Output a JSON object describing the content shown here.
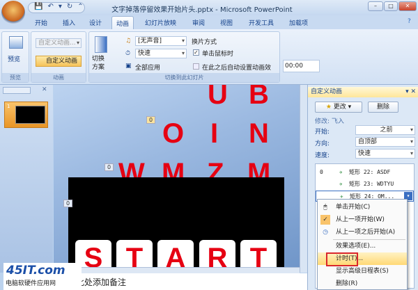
{
  "window": {
    "title": "文字掉落停留效果开始片头.pptx - Microsoft PowerPoint",
    "controls": [
      "–",
      "□",
      "✕"
    ]
  },
  "qat": {
    "items": [
      "💾",
      "↶",
      "▾",
      "↻",
      "⌃"
    ]
  },
  "tabs": [
    "开始",
    "插入",
    "设计",
    "动画",
    "幻灯片放映",
    "审阅",
    "视图",
    "开发工具",
    "加载项"
  ],
  "active_tab": "动画",
  "ribbon": {
    "preview": {
      "button": "预览",
      "group": "预览"
    },
    "animation": {
      "dropdown": "自定义动画...",
      "custom_button": "自定义动画",
      "group": "动画"
    },
    "transition": {
      "scheme_button": "切换方案",
      "sound": "[无声音]",
      "speed": "快速",
      "apply_all": "全部应用",
      "advance_title": "换片方式",
      "on_click": "单击鼠标时",
      "on_click_checked": true,
      "auto_after": "在此之后自动设置动画效果:",
      "auto_after_checked": false,
      "time": "00:00",
      "group": "切换到此幻灯片"
    }
  },
  "thumbnail": {
    "number": "1"
  },
  "slide": {
    "letters_row1": [
      "U",
      "B"
    ],
    "letters_row2": [
      "O",
      "I",
      "N"
    ],
    "letters_row3": [
      "W",
      "M",
      "Z",
      "M"
    ],
    "tiles": [
      "S",
      "T",
      "A",
      "R",
      "T"
    ],
    "tags": [
      "0",
      "0",
      "0"
    ]
  },
  "notes": {
    "placeholder": "单击此处添加备注"
  },
  "watermark": {
    "logo": "45IT.com",
    "tagline": "电脑软硬件应用网"
  },
  "task_pane": {
    "title": "自定义动画",
    "change_button": "更改",
    "remove_button": "删除",
    "modify": "修改: 飞入",
    "start_label": "开始:",
    "start_value": "之前",
    "direction_label": "方向:",
    "direction_value": "自顶部",
    "speed_label": "速度:",
    "speed_value": "快速",
    "list": [
      {
        "index": "0",
        "label": "矩形 22: ASDF"
      },
      {
        "index": "",
        "label": "矩形 23: WDTYU"
      },
      {
        "index": "",
        "label": "矩形 24: OM..."
      }
    ]
  },
  "context_menu": {
    "items": [
      "单击开始(C)",
      "从上一项开始(W)",
      "从上一项之后开始(A)",
      "效果选项(E)...",
      "计时(T)...",
      "显示高级日程表(S)",
      "删除(R)"
    ],
    "checked": "从上一项开始(W)",
    "highlighted": "计时(T)..."
  },
  "colors": {
    "letter": "#e60012",
    "highlight_box": "#d9262c",
    "ribbon": "#dde8f6"
  }
}
